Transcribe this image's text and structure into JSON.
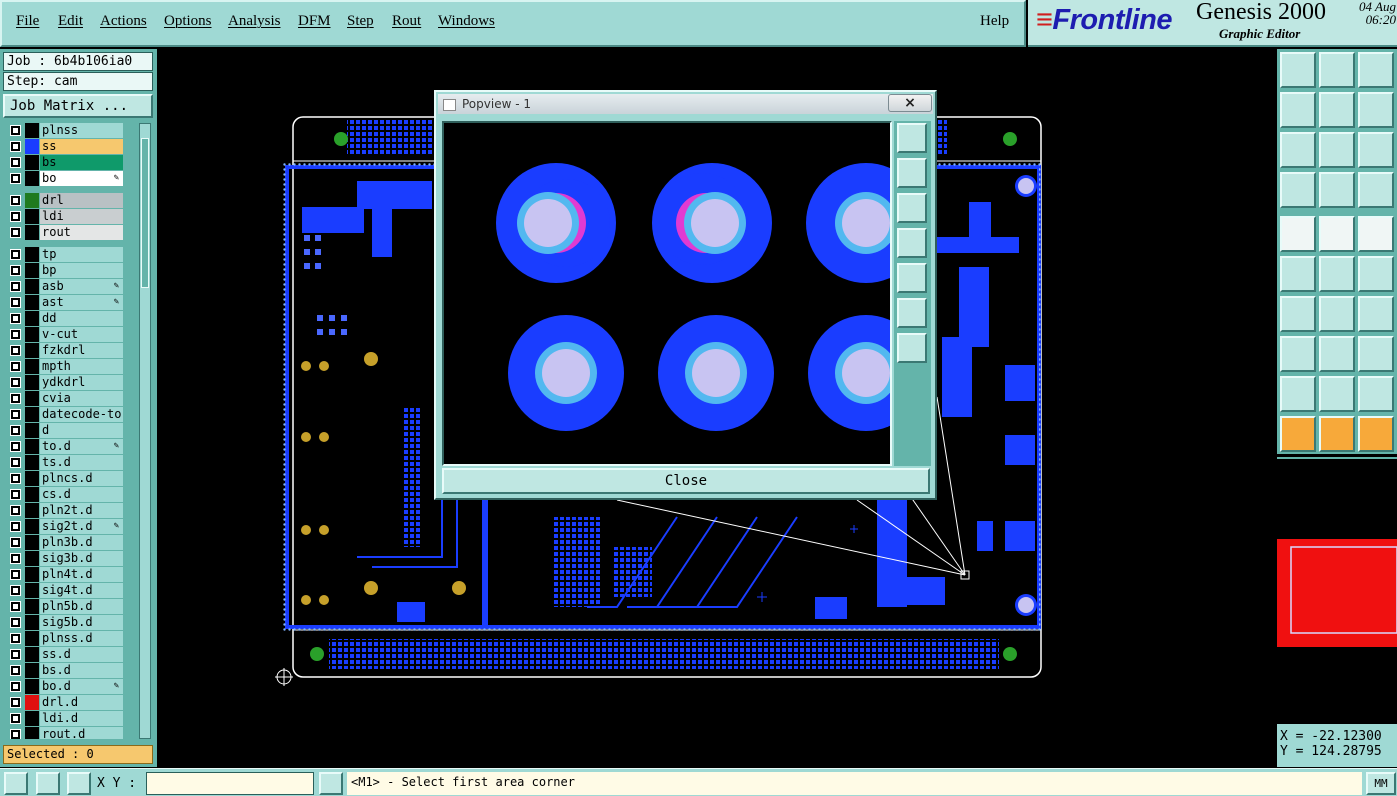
{
  "menu": {
    "items": [
      "File",
      "Edit",
      "Actions",
      "Options",
      "Analysis",
      "DFM",
      "Step",
      "Rout",
      "Windows"
    ],
    "help": "Help"
  },
  "brand": {
    "logo": "Frontline",
    "product": "Genesis 2000",
    "subtitle": "Graphic Editor",
    "date": "04 Aug",
    "time": "06:20"
  },
  "left": {
    "job": "Job : 6b4b106ia0",
    "step": "Step: cam",
    "job_matrix_label": "Job Matrix ...",
    "selected": "Selected : 0",
    "layers": [
      {
        "name": "plnss",
        "color": "#000000",
        "active": false,
        "edit": false
      },
      {
        "name": "ss",
        "color": "#1a3dff",
        "active": true,
        "highlight": "#f6c86e",
        "edit": false
      },
      {
        "name": "bs",
        "color": "#000000",
        "active": false,
        "highlight": "#0f9a6a",
        "edit": false
      },
      {
        "name": "bo",
        "color": "#000000",
        "active": false,
        "highlight": "#ffffff",
        "edit": true
      },
      {
        "name": "drl",
        "color": "#1f7a1f",
        "active": false,
        "highlight": "#b9c1c4",
        "edit": false
      },
      {
        "name": "ldi",
        "color": "#000000",
        "active": false,
        "highlight": "#c9ced0",
        "edit": false
      },
      {
        "name": "rout",
        "color": "#000000",
        "active": false,
        "highlight": "#e4e6e6",
        "edit": false
      },
      {
        "name": "tp",
        "color": "#000000",
        "active": false,
        "edit": false
      },
      {
        "name": "bp",
        "color": "#000000",
        "active": false,
        "edit": false
      },
      {
        "name": "asb",
        "color": "#000000",
        "active": false,
        "edit": true
      },
      {
        "name": "ast",
        "color": "#000000",
        "active": false,
        "edit": true
      },
      {
        "name": "dd",
        "color": "#000000",
        "active": false,
        "edit": false
      },
      {
        "name": "v-cut",
        "color": "#000000",
        "active": false,
        "edit": false
      },
      {
        "name": "fzkdrl",
        "color": "#000000",
        "active": false,
        "edit": false
      },
      {
        "name": "mpth",
        "color": "#000000",
        "active": false,
        "edit": false
      },
      {
        "name": "ydkdrl",
        "color": "#000000",
        "active": false,
        "edit": false
      },
      {
        "name": "cvia",
        "color": "#000000",
        "active": false,
        "edit": false
      },
      {
        "name": "datecode-to",
        "color": "#000000",
        "active": false,
        "edit": false
      },
      {
        "name": "d",
        "color": "#000000",
        "active": false,
        "edit": false
      },
      {
        "name": "to.d",
        "color": "#000000",
        "active": false,
        "edit": true
      },
      {
        "name": "ts.d",
        "color": "#000000",
        "active": false,
        "edit": false
      },
      {
        "name": "plncs.d",
        "color": "#000000",
        "active": false,
        "edit": false
      },
      {
        "name": "cs.d",
        "color": "#000000",
        "active": false,
        "edit": false
      },
      {
        "name": "pln2t.d",
        "color": "#000000",
        "active": false,
        "edit": false
      },
      {
        "name": "sig2t.d",
        "color": "#000000",
        "active": false,
        "edit": true
      },
      {
        "name": "pln3b.d",
        "color": "#000000",
        "active": false,
        "edit": false
      },
      {
        "name": "sig3b.d",
        "color": "#000000",
        "active": false,
        "edit": false
      },
      {
        "name": "pln4t.d",
        "color": "#000000",
        "active": false,
        "edit": false
      },
      {
        "name": "sig4t.d",
        "color": "#000000",
        "active": false,
        "edit": false
      },
      {
        "name": "pln5b.d",
        "color": "#000000",
        "active": false,
        "edit": false
      },
      {
        "name": "sig5b.d",
        "color": "#000000",
        "active": false,
        "edit": false
      },
      {
        "name": "plnss.d",
        "color": "#000000",
        "active": false,
        "edit": false
      },
      {
        "name": "ss.d",
        "color": "#000000",
        "active": false,
        "edit": false
      },
      {
        "name": "bs.d",
        "color": "#000000",
        "active": false,
        "edit": false
      },
      {
        "name": "bo.d",
        "color": "#000000",
        "active": false,
        "edit": true
      },
      {
        "name": "drl.d",
        "color": "#e01010",
        "active": false,
        "highlight": "#9fd9d4",
        "edit": false
      },
      {
        "name": "ldi.d",
        "color": "#000000",
        "active": false,
        "edit": false
      },
      {
        "name": "rout.d",
        "color": "#000000",
        "active": false,
        "edit": false
      }
    ]
  },
  "popview": {
    "title": "Popview - 1",
    "close_x": "×",
    "close_label": "Close"
  },
  "coords": {
    "x": "X = -22.12300",
    "y": "Y = 124.28795"
  },
  "status": {
    "xy_label": "X Y :",
    "xy_value": "",
    "message": "<M1> - Select first area corner",
    "unit": "MM"
  },
  "colors": {
    "panel": "#9fd9d4",
    "panel_dark": "#64b4aa",
    "copper": "#1a3dff",
    "pad_ring": "#52b8f0",
    "drill": "#c8c4f2",
    "highlight": "#f6c86e"
  }
}
